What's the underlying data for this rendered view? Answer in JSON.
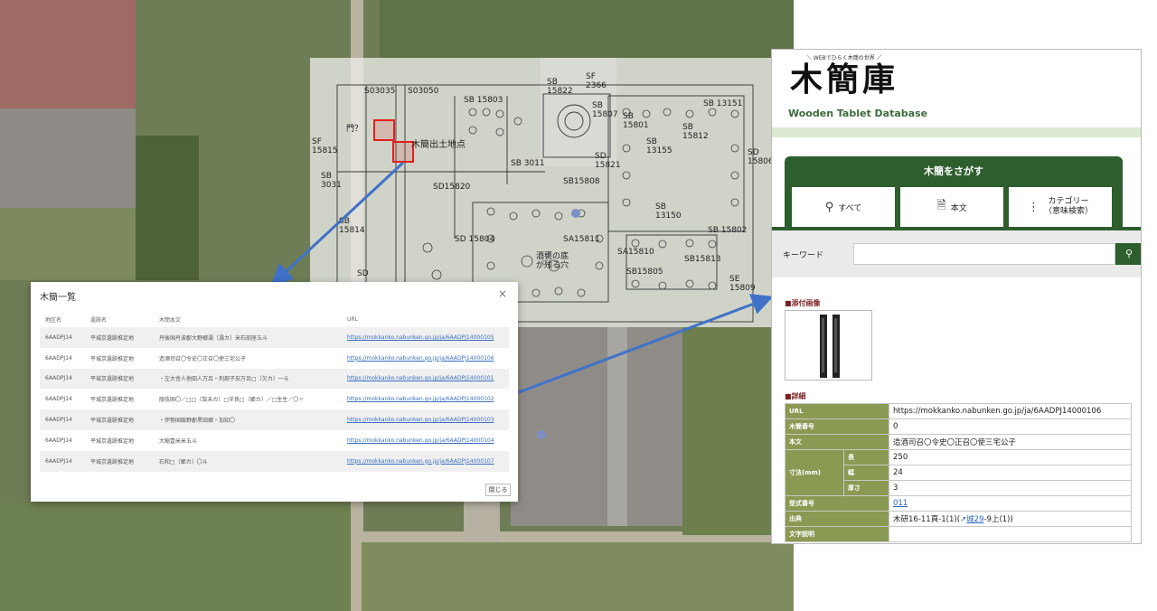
{
  "plan": {
    "labels": [
      "S03035",
      "S03050",
      "SB 15803",
      "SB\n15822",
      "SF\n2366",
      "SB\n15807",
      "SB\n15801",
      "SB 13151",
      "SB\n15812",
      "SF\n15815",
      "SB\n3031",
      "SB 3011",
      "SD\n15821",
      "SB15808",
      "SB\n13150",
      "SB 15802",
      "SD\n15806",
      "SD15820",
      "SB\n15814",
      "SD 15804",
      "SA15811",
      "SA15810",
      "SB15805",
      "SB15813",
      "SD",
      "SE\n15809",
      "SB\n13155",
      "門？"
    ],
    "site_label": "木簡出土地点",
    "pit_label": "酒甕の底\nが残る穴"
  },
  "dialog": {
    "title": "木簡一覧",
    "close_icon": "×",
    "columns": [
      "地区名",
      "遺跡名",
      "木簡本文",
      "URL"
    ],
    "rows": [
      {
        "area": "6AADPJ14",
        "site": "平城京遺跡推定地",
        "text": "丹後国丹波郡大野郷湯〔湯カ〕米石部座五斗",
        "url": "https://mokkanko.nabunken.go.jp/ja/6AADPJ14000105"
      },
      {
        "area": "6AADPJ14",
        "site": "平城京遺跡推定地",
        "text": "造酒司召〇令史〇正召〇使三宅公子",
        "url": "https://mokkanko.nabunken.go.jp/ja/6AADPJ14000106"
      },
      {
        "area": "6AADPJ14",
        "site": "平城京遺跡推定地",
        "text": "・左大舎人他田人万呂・刑部子奈万呂□〔欠カ〕一斗",
        "url": "https://mokkanko.nabunken.go.jp/ja/6AADPJ14000101"
      },
      {
        "area": "6AADPJ14",
        "site": "平城京遺跡推定地",
        "text": "隠伎国〇／□□〔梨未カ〕□半良□〔郷カ〕／□生生／〇〃",
        "url": "https://mokkanko.nabunken.go.jp/ja/6AADPJ14000102"
      },
      {
        "area": "6AADPJ14",
        "site": "平城京遺跡推定地",
        "text": "・伊勢国飯野郡黒田郷・加知〇",
        "url": "https://mokkanko.nabunken.go.jp/ja/6AADPJ14000103"
      },
      {
        "area": "6AADPJ14",
        "site": "平城京遺跡推定地",
        "text": "大鰯壹米米五斗",
        "url": "https://mokkanko.nabunken.go.jp/ja/6AADPJ14000104"
      },
      {
        "area": "6AADPJ14",
        "site": "平城京遺跡推定地",
        "text": "石和□〔郷カ〕〇斗",
        "url": "https://mokkanko.nabunken.go.jp/ja/6AADPJ14000107"
      }
    ],
    "close_button": "閉じる"
  },
  "panel": {
    "tagline": "＼ WEBでひらく木簡の世界 ／",
    "logo": "木簡庫",
    "logo_sub": "Wooden Tablet Database",
    "search_title": "木簡をさがす",
    "tabs": [
      {
        "icon": "search-icon",
        "label": "すべて"
      },
      {
        "icon": "document-search-icon",
        "label": "本文"
      },
      {
        "icon": "category-icon",
        "label": "カテゴリー\n（意味検索）"
      }
    ],
    "keyword_label": "キーワード",
    "keyword_value": "",
    "image_heading": "■添付画像",
    "detail_heading": "■詳細",
    "details": {
      "url_label": "URL",
      "url_value": "https://mokkanko.nabunken.go.jp/ja/6AADPJ14000106",
      "number_label": "木簡番号",
      "number_value": "0",
      "text_label": "本文",
      "text_value": "造酒司召〇令史〇正召〇使三宅公子",
      "size_label": "寸法(mm)",
      "length_label": "長",
      "length_value": "250",
      "width_label": "幅",
      "width_value": "24",
      "thick_label": "厚さ",
      "thick_value": "3",
      "type_label": "型式番号",
      "type_value": "011",
      "source_label": "出典",
      "source_prefix": "木研16-11頁-1(1)(",
      "source_link": "城29",
      "source_suffix": "-9上(1))",
      "char_label": "文字説明"
    }
  }
}
